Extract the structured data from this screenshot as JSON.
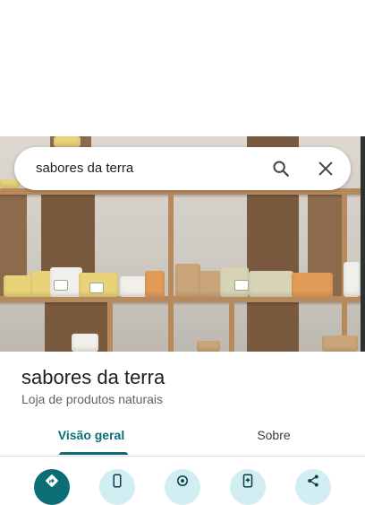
{
  "search": {
    "query": "sabores da terra"
  },
  "place": {
    "name": "sabores da terra",
    "category": "Loja de produtos naturais"
  },
  "tabs": [
    {
      "label": "Visão geral",
      "active": true
    },
    {
      "label": "Sobre",
      "active": false
    }
  ],
  "actions": [
    {
      "icon": "directions-icon"
    },
    {
      "icon": "phone-icon"
    },
    {
      "icon": "nearby-icon"
    },
    {
      "icon": "add-to-phone-icon"
    },
    {
      "icon": "share-icon"
    }
  ],
  "colors": {
    "accent": "#0b6e76",
    "action_bg": "#d3eef2"
  }
}
